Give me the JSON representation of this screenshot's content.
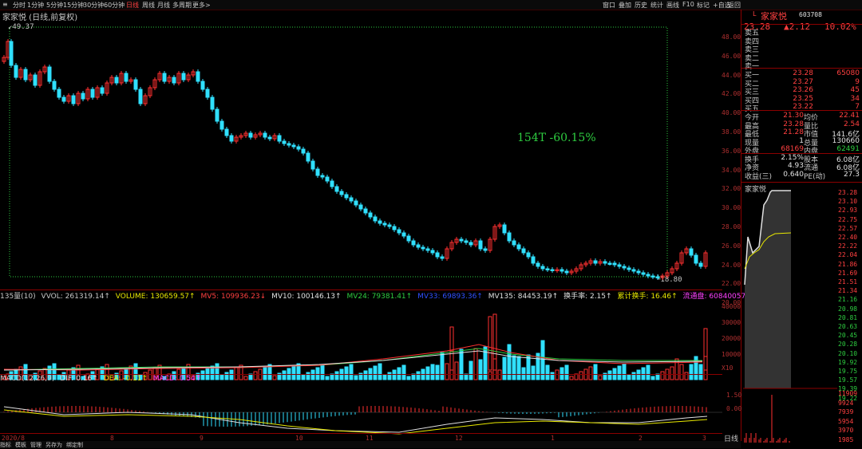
{
  "toolbar": {
    "left": [
      "分时",
      "1分钟",
      "5分钟",
      "15分钟",
      "30分钟",
      "60分钟",
      "日线",
      "周线",
      "月线",
      "多周期",
      "更多>"
    ],
    "active": "日线",
    "right": [
      "窗口",
      "叠加",
      "历史",
      "统计",
      "画线",
      "F10",
      "标记",
      "+自选",
      "返回"
    ]
  },
  "chart": {
    "title": "家家悦 (日线,前复权)",
    "high_label": "49.37",
    "low_label": "18.80",
    "annotation": "154T -60.15%",
    "price_axis": [
      "48.00",
      "46.00",
      "44.00",
      "42.00",
      "40.00",
      "38.00",
      "36.00",
      "34.00",
      "32.00",
      "30.00",
      "28.00",
      "26.00",
      "24.00",
      "22.00",
      "20.00"
    ],
    "vol_axis": [
      "40000",
      "30000",
      "20000",
      "10000",
      "X10"
    ],
    "macd_axis": [
      "1.50",
      "0.00"
    ],
    "dates": [
      "8",
      "9",
      "10",
      "11",
      "12",
      "1",
      "2",
      "3"
    ],
    "start_date": "2020/8"
  },
  "volume_ind": {
    "name": "135量(10)",
    "vvol": "VVOL: 261319.14↑",
    "volume": "VOLUME: 130659.57↑",
    "mv5": "MV5: 109936.23↓",
    "mv10": "MV10: 100146.13↑",
    "mv24": "MV24: 79381.41↑",
    "mv33": "MV33: 69893.36↑",
    "mv135": "MV135: 84453.19↑",
    "turnover": "换手率: 2.15↑",
    "cum_turnover": "累计换手: 16.46↑",
    "float_cap": "流通盘: 60840057"
  },
  "macd_ind": {
    "name": "MACD(12,26,9)",
    "dif": "DIF: 0.16↑",
    "dea": "DEA: -0.11↑",
    "macd": "MACD: 0.54↑"
  },
  "bottom_tabs": [
    "指标",
    "模板",
    "管理",
    "另存为",
    "绑定制"
  ],
  "quote": {
    "code": "603708",
    "name": "家家悦",
    "price": "23.28",
    "change": "▲2.12",
    "pct": "10.02%",
    "sell_labels": [
      "卖五",
      "卖四",
      "卖三",
      "卖二",
      "卖一"
    ],
    "buy": [
      {
        "label": "买一",
        "price": "23.28",
        "vol": "65080"
      },
      {
        "label": "买二",
        "price": "23.27",
        "vol": "9"
      },
      {
        "label": "买三",
        "price": "23.26",
        "vol": "45"
      },
      {
        "label": "买四",
        "price": "23.25",
        "vol": "34"
      },
      {
        "label": "买五",
        "price": "23.22",
        "vol": "7"
      }
    ],
    "stats": [
      {
        "l1": "今开",
        "v1": "21.30",
        "l2": "均价",
        "v2": "22.41",
        "c1": "red",
        "c2": "red"
      },
      {
        "l1": "最高",
        "v1": "23.28",
        "l2": "量比",
        "v2": "2.54",
        "c1": "red",
        "c2": "red"
      },
      {
        "l1": "最低",
        "v1": "21.28",
        "l2": "市值",
        "v2": "141.6亿",
        "c1": "red",
        "c2": "white"
      },
      {
        "l1": "现量",
        "v1": "1",
        "l2": "总量",
        "v2": "130660",
        "c1": "white",
        "c2": "white"
      },
      {
        "l1": "外盘",
        "v1": "68169",
        "l2": "内盘",
        "v2": "62491",
        "c1": "red",
        "c2": "green"
      },
      {
        "l1": "换手",
        "v1": "2.15%",
        "l2": "股本",
        "v2": "6.08亿",
        "c1": "white",
        "c2": "white"
      },
      {
        "l1": "净资",
        "v1": "4.93",
        "l2": "流通",
        "v2": "6.08亿",
        "c1": "white",
        "c2": "white"
      },
      {
        "l1": "收益(三)",
        "v1": "0.640",
        "l2": "PE(动)",
        "v2": "27.3",
        "c1": "white",
        "c2": "white"
      }
    ],
    "mini_axis": [
      "23.28",
      "23.10",
      "22.93",
      "22.75",
      "22.57",
      "22.40",
      "22.22",
      "22.04",
      "21.86",
      "21.69",
      "21.51",
      "21.34",
      "21.16",
      "20.98",
      "20.81",
      "20.63",
      "20.45",
      "20.28",
      "20.10",
      "19.92",
      "19.75",
      "19.57",
      "19.39",
      "19.22"
    ],
    "mini_vol_axis": [
      "11909",
      "9924",
      "7939",
      "5954",
      "3970",
      "1985"
    ],
    "mini_tab": "日线"
  }
}
